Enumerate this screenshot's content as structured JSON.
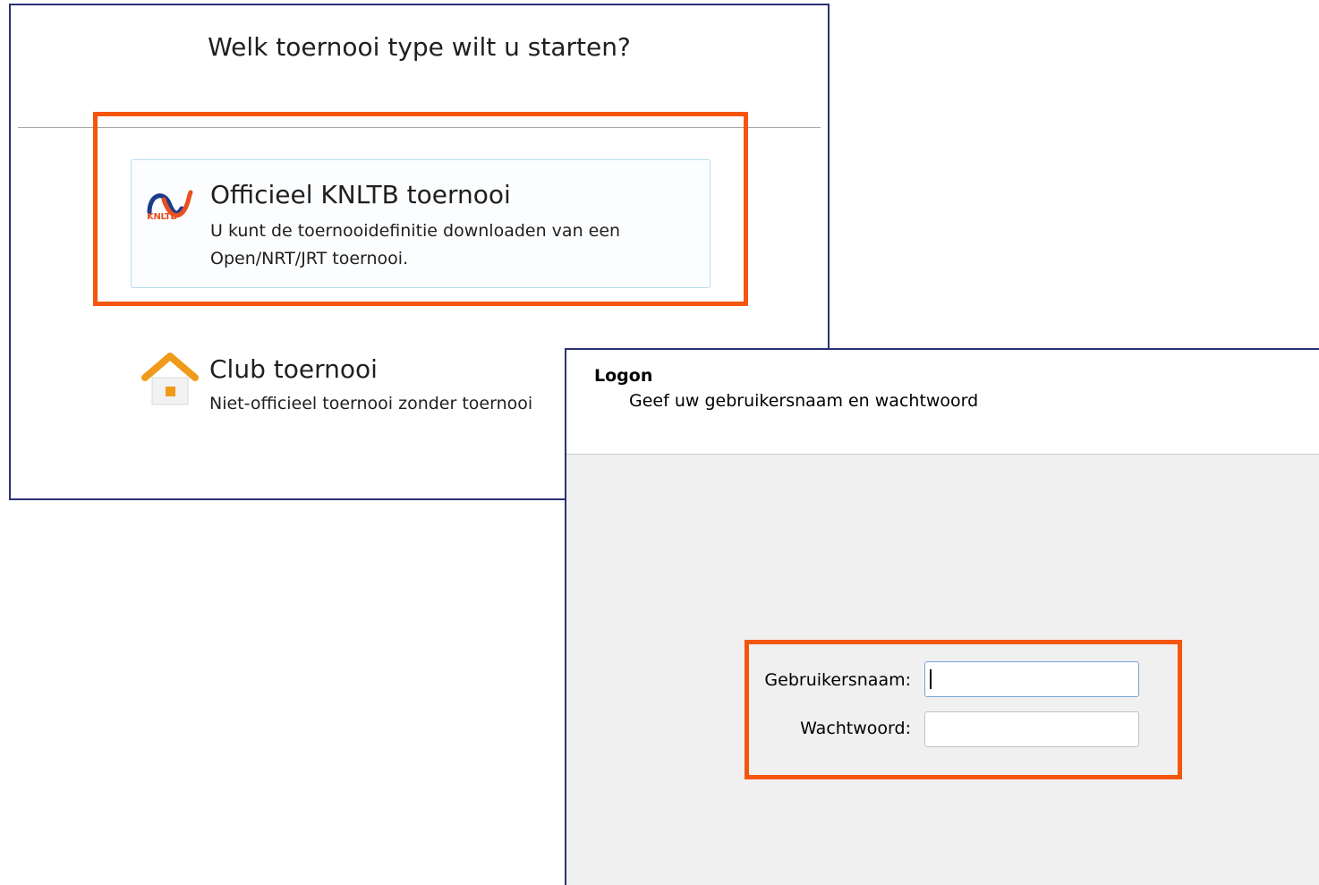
{
  "tournament_dialog": {
    "title": "Welk toernooi type wilt u starten?",
    "options": [
      {
        "icon": "knltb-logo-icon",
        "logo_text": "KNLTB",
        "title": "Officieel KNLTB toernooi",
        "description": "U kunt de toernooidefinitie downloaden van een Open/NRT/JRT toernooi."
      },
      {
        "icon": "house-icon",
        "title": "Club toernooi",
        "description": "Niet-officieel toernooi zonder toernooi"
      }
    ]
  },
  "logon_dialog": {
    "title": "Logon",
    "subtitle": "Geef uw gebruikersnaam en wachtwoord",
    "username_label": "Gebruikersnaam:",
    "username_value": "",
    "password_label": "Wachtwoord:",
    "password_value": ""
  },
  "colors": {
    "highlight": "#f5560e",
    "dialog_border": "#2a3275",
    "knltb_orange": "#e9501e",
    "knltb_blue": "#1b3b8c",
    "house_orange": "#f09a1a"
  }
}
